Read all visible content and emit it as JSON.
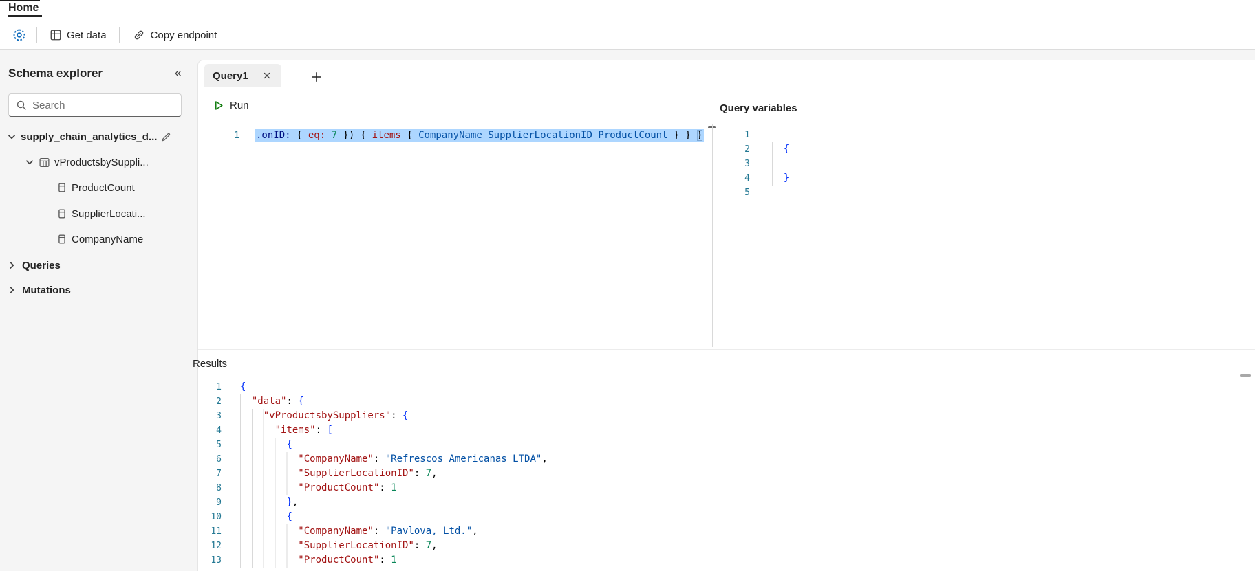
{
  "menubar": {
    "home": "Home"
  },
  "toolbar": {
    "get_data": "Get data",
    "copy_endpoint": "Copy endpoint"
  },
  "sidebar": {
    "title": "Schema explorer",
    "search_placeholder": "Search",
    "tree": [
      {
        "label": "supply_chain_analytics_d..."
      },
      {
        "label": "vProductsbySuppli..."
      },
      {
        "label": "ProductCount"
      },
      {
        "label": "SupplierLocati..."
      },
      {
        "label": "CompanyName"
      },
      {
        "label": "Queries"
      },
      {
        "label": "Mutations"
      }
    ]
  },
  "query_tab": {
    "label": "Query1"
  },
  "editor": {
    "run_label": "Run",
    "line_numbers": [
      "1"
    ],
    "query_line": [
      [
        "gqa",
        ".onID:"
      ],
      [
        "pln",
        " { "
      ],
      [
        "gqk",
        "eq:"
      ],
      [
        "pln",
        " "
      ],
      [
        "num",
        "7"
      ],
      [
        "pln",
        " }) { "
      ],
      [
        "gqk",
        "items"
      ],
      [
        "pln",
        " { "
      ],
      [
        "gqf",
        "CompanyName"
      ],
      [
        "pln",
        " "
      ],
      [
        "gqf",
        "SupplierLocationID"
      ],
      [
        "pln",
        " "
      ],
      [
        "gqf",
        "ProductCount"
      ],
      [
        "pln",
        " } } "
      ],
      [
        "brkm",
        "}"
      ]
    ]
  },
  "variables": {
    "title": "Query variables",
    "line_numbers": [
      "1",
      "2",
      "3",
      "4",
      "5"
    ],
    "lines": [
      {
        "g": 0,
        "t": []
      },
      {
        "g": 1,
        "t": [
          [
            "ws",
            "  "
          ],
          [
            "brk",
            "{"
          ]
        ]
      },
      {
        "g": 1,
        "t": []
      },
      {
        "g": 1,
        "t": [
          [
            "ws",
            "  "
          ],
          [
            "brk",
            "}"
          ]
        ]
      },
      {
        "g": 0,
        "t": []
      }
    ]
  },
  "results": {
    "title": "Results",
    "line_numbers": [
      "1",
      "2",
      "3",
      "4",
      "5",
      "6",
      "7",
      "8",
      "9",
      "10",
      "11",
      "12",
      "13"
    ],
    "lines": [
      {
        "g": 0,
        "t": [
          [
            "brk",
            "{"
          ]
        ]
      },
      {
        "g": 1,
        "t": [
          [
            "ws",
            "  "
          ],
          [
            "key",
            "\"data\""
          ],
          [
            "pln",
            ": "
          ],
          [
            "brk",
            "{"
          ]
        ]
      },
      {
        "g": 2,
        "t": [
          [
            "ws",
            "    "
          ],
          [
            "key",
            "\"vProductsbySuppliers\""
          ],
          [
            "pln",
            ": "
          ],
          [
            "brk",
            "{"
          ]
        ]
      },
      {
        "g": 3,
        "t": [
          [
            "ws",
            "      "
          ],
          [
            "key",
            "\"items\""
          ],
          [
            "pln",
            ": "
          ],
          [
            "brk",
            "["
          ]
        ]
      },
      {
        "g": 4,
        "t": [
          [
            "ws",
            "        "
          ],
          [
            "brk",
            "{"
          ]
        ]
      },
      {
        "g": 5,
        "t": [
          [
            "ws",
            "          "
          ],
          [
            "key",
            "\"CompanyName\""
          ],
          [
            "pln",
            ": "
          ],
          [
            "str",
            "\"Refrescos Americanas LTDA\""
          ],
          [
            "pln",
            ","
          ]
        ]
      },
      {
        "g": 5,
        "t": [
          [
            "ws",
            "          "
          ],
          [
            "key",
            "\"SupplierLocationID\""
          ],
          [
            "pln",
            ": "
          ],
          [
            "num",
            "7"
          ],
          [
            "pln",
            ","
          ]
        ]
      },
      {
        "g": 5,
        "t": [
          [
            "ws",
            "          "
          ],
          [
            "key",
            "\"ProductCount\""
          ],
          [
            "pln",
            ": "
          ],
          [
            "num",
            "1"
          ]
        ]
      },
      {
        "g": 4,
        "t": [
          [
            "ws",
            "        "
          ],
          [
            "brk",
            "}"
          ],
          [
            "pln",
            ","
          ]
        ]
      },
      {
        "g": 4,
        "t": [
          [
            "ws",
            "        "
          ],
          [
            "brk",
            "{"
          ]
        ]
      },
      {
        "g": 5,
        "t": [
          [
            "ws",
            "          "
          ],
          [
            "key",
            "\"CompanyName\""
          ],
          [
            "pln",
            ": "
          ],
          [
            "str",
            "\"Pavlova, Ltd.\""
          ],
          [
            "pln",
            ","
          ]
        ]
      },
      {
        "g": 5,
        "t": [
          [
            "ws",
            "          "
          ],
          [
            "key",
            "\"SupplierLocationID\""
          ],
          [
            "pln",
            ": "
          ],
          [
            "num",
            "7"
          ],
          [
            "pln",
            ","
          ]
        ]
      },
      {
        "g": 5,
        "t": [
          [
            "ws",
            "          "
          ],
          [
            "key",
            "\"ProductCount\""
          ],
          [
            "pln",
            ": "
          ],
          [
            "num",
            "1"
          ]
        ]
      }
    ]
  },
  "colors": {
    "accent": "#0f6cbd",
    "selection": "#add6ff",
    "json_key": "#a31515",
    "json_string": "#0451a5",
    "json_number": "#098658",
    "bracket": "#0431fa",
    "line_number": "#237893"
  }
}
